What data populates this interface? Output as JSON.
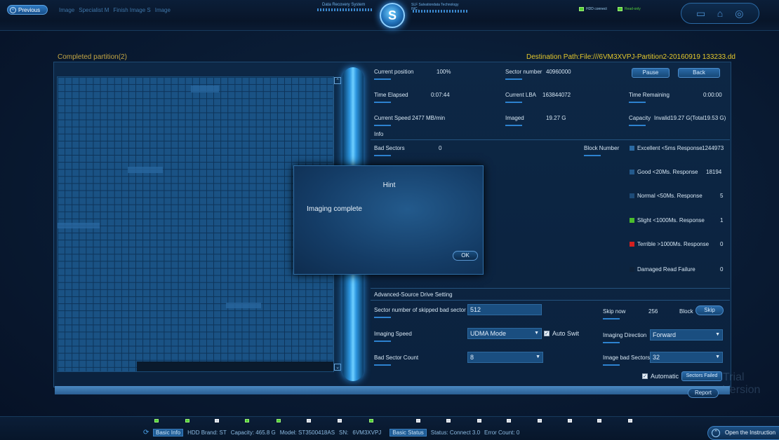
{
  "topbar": {
    "previous_label": "Previous",
    "crumbs": [
      "Image",
      "Specialist M",
      "Finish Image S",
      "Image"
    ],
    "system_title": "Data Recovery System",
    "logo_glyph": "S",
    "company": "SLF Salvationdata Technology",
    "company_sub": "INC.",
    "hdd_connect": "HDD connect",
    "read_only": "Read-only",
    "icons": [
      "monitor-icon",
      "home-icon",
      "settings-icon"
    ]
  },
  "header": {
    "completed_partition": "Completed partition(2)",
    "destination_path": "Destination Path:File:///6VM3XVPJ-Partition2-20160919 133233.dd"
  },
  "stats": {
    "current_position_label": "Current position",
    "current_position_value": "100%",
    "sector_number_label": "Sector number",
    "sector_number_value": "40960000",
    "pause_label": "Pause",
    "back_label": "Back",
    "time_elapsed_label": "Time Elapsed",
    "time_elapsed_value": "0:07:44",
    "current_lba_label": "Current LBA",
    "current_lba_value": "163844072",
    "time_remaining_label": "Time Remaining",
    "time_remaining_value": "0:00:00",
    "current_speed_label": "Current Speed",
    "current_speed_value": "2477 MB/min",
    "imaged_label": "Imaged",
    "imaged_value": "19.27 G",
    "capacity_label": "Capacity",
    "capacity_value": "Invalid19.27 G(Total19.53 G)",
    "info_label": "Info",
    "bad_sectors_label": "Bad Sectors",
    "bad_sectors_value": "0",
    "block_number_label": "Block Number"
  },
  "legend": [
    {
      "label": "Excellent <5ms Response",
      "value": "1244973",
      "color": "#2b6aa3"
    },
    {
      "label": "Good    <20Ms. Response",
      "value": "18194",
      "color": "#23598c"
    },
    {
      "label": "Normal  <50Ms. Response",
      "value": "5",
      "color": "#1d4b78"
    },
    {
      "label": "Slight  <1000Ms. Response",
      "value": "1",
      "color": "#4bbd2c"
    },
    {
      "label": "Terrible >1000Ms. Response",
      "value": "0",
      "color": "#d42020"
    },
    {
      "label": "Damaged  Read Failure",
      "value": "0",
      "color": "#0e2138"
    }
  ],
  "hint": {
    "title": "Hint",
    "message": "Imaging complete",
    "ok_label": "OK"
  },
  "advanced": {
    "title": "Advanced-Source Drive Setting",
    "skipped_label": "Sector number of skipped bad sector",
    "skipped_value": "512",
    "skip_now_label": "Skip now",
    "skip_now_value": "256",
    "block_label": "Block",
    "skip_btn": "Skip",
    "imaging_speed_label": "Imaging Speed",
    "imaging_speed_value": "UDMA Mode",
    "auto_switch_label": "Auto Swit",
    "imaging_direction_label": "Imaging Direction",
    "imaging_direction_value": "Forward",
    "bad_sector_count_label": "Bad Sector Count",
    "bad_sector_count_value": "8",
    "image_bad_sectors_label": "Image bad Sectors",
    "image_bad_sectors_value": "32",
    "automatic_label": "Automatic",
    "sectors_failed_label": "Sectors Failed"
  },
  "report_label": "Report",
  "trial_text": "Trial Version",
  "bottom": {
    "basic_info": "Basic Info",
    "hdd_brand": "HDD Brand: ST",
    "capacity": "Capacity: 465.8 G",
    "model": "Model: ST3500418AS",
    "sn": "SN:",
    "sn_value": "6VM3XVPJ",
    "basic_status": "Basic Status",
    "status": "Status: Connect 3.0",
    "error_count": "Error Count: 0",
    "open_instruction": "Open the Instruction"
  }
}
